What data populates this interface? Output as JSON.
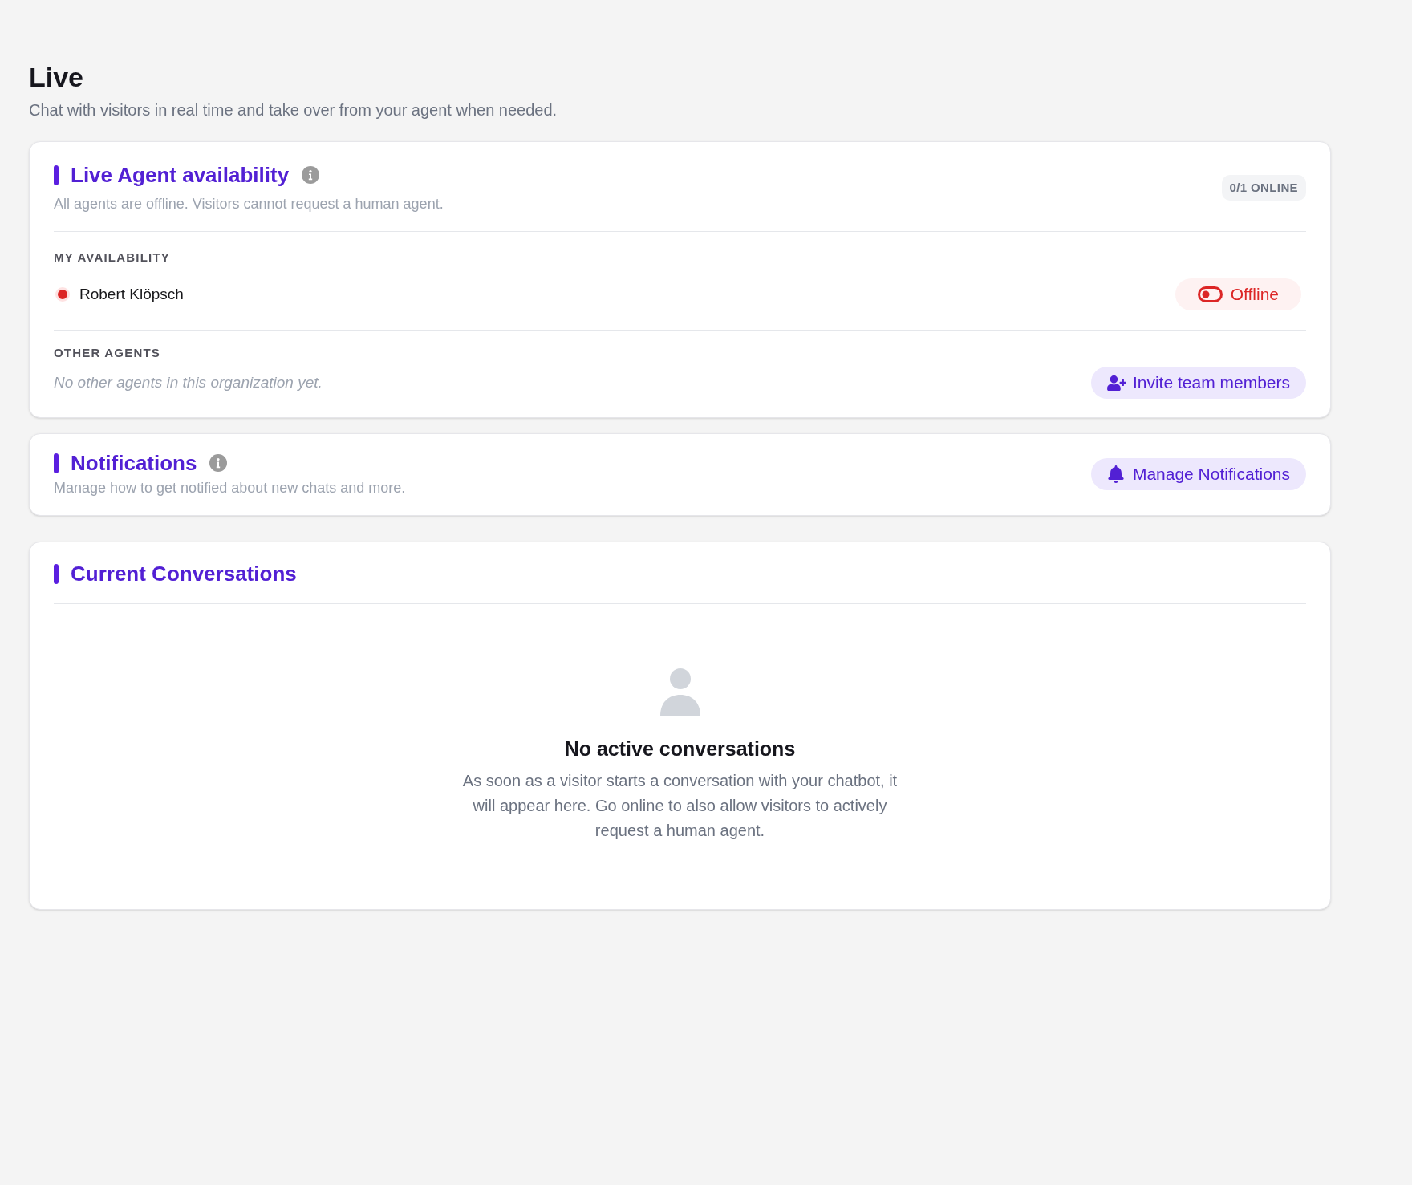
{
  "page": {
    "title": "Live",
    "subtitle": "Chat with visitors in real time and take over from your agent when needed."
  },
  "availability": {
    "title": "Live Agent availability",
    "description": "All agents are offline. Visitors cannot request a human agent.",
    "online_count": "0/1 ONLINE",
    "my_availability": {
      "heading": "MY AVAILABILITY",
      "agent": {
        "name": "Robert Klöpsch",
        "online": false
      },
      "toggle_label": "Offline"
    },
    "other_agents": {
      "heading": "OTHER AGENTS",
      "empty_text": "No other agents in this organization yet.",
      "invite_button": "Invite team members"
    }
  },
  "notifications": {
    "title": "Notifications",
    "description": "Manage how to get notified about new chats and more.",
    "button": "Manage Notifications"
  },
  "conversations": {
    "title": "Current Conversations",
    "empty_state": {
      "title": "No active conversations",
      "message": "As soon as a visitor starts a conversation with your chatbot, it will appear here. Go online to also allow visitors to actively request a human agent."
    }
  }
}
